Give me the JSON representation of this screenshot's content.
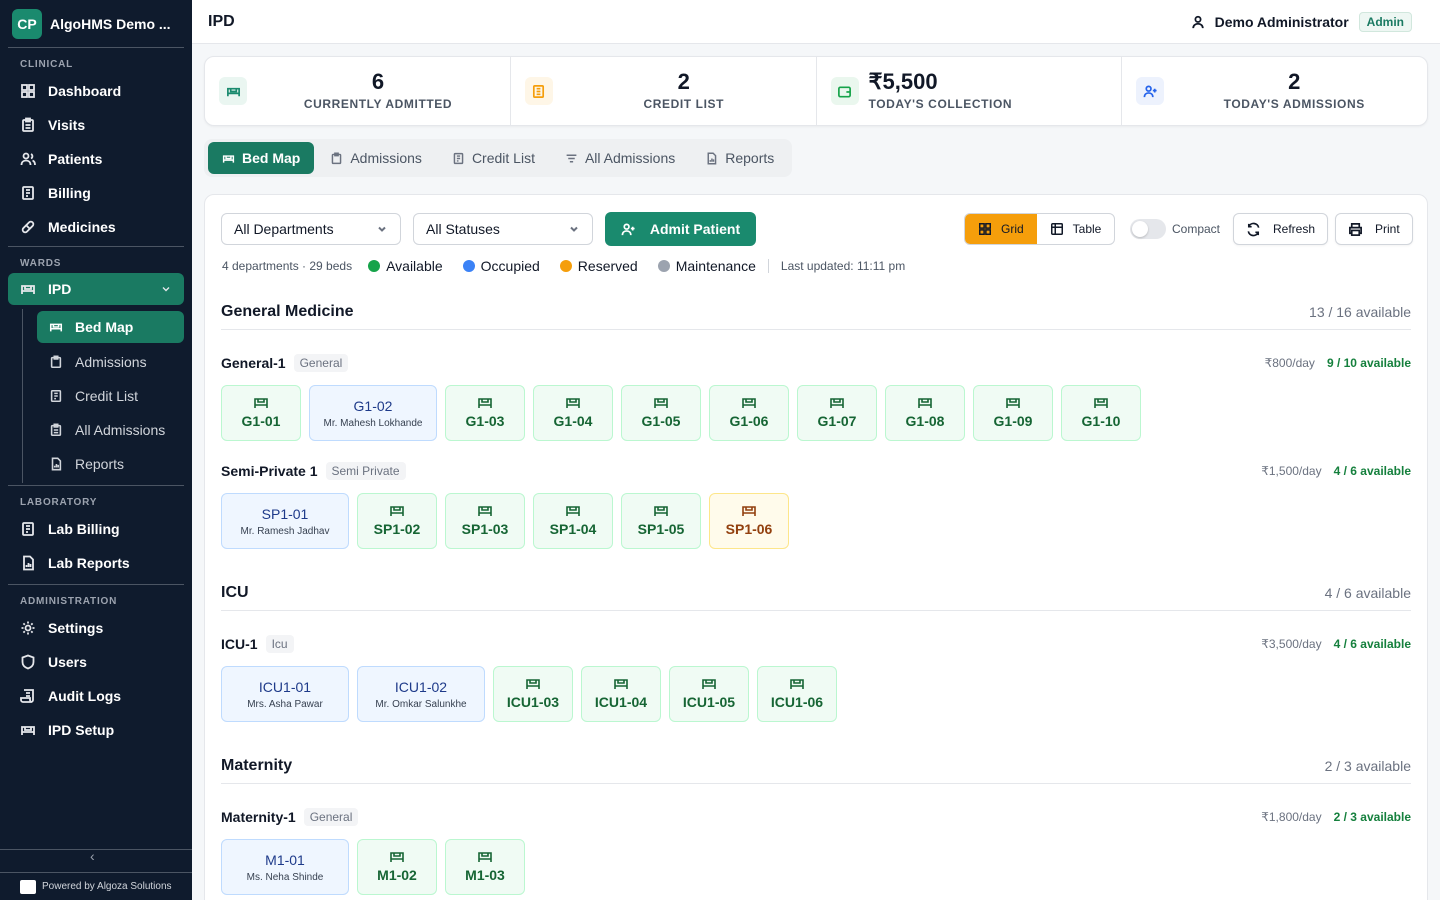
{
  "brand": {
    "initials": "CP",
    "name": "AlgoHMS Demo ..."
  },
  "sidebar": {
    "sections": [
      {
        "label": "CLINICAL",
        "items": [
          "Dashboard",
          "Visits",
          "Patients",
          "Billing",
          "Medicines"
        ]
      },
      {
        "label": "WARDS",
        "active": "IPD",
        "sub": [
          "Bed Map",
          "Admissions",
          "Credit List",
          "All Admissions",
          "Reports"
        ]
      },
      {
        "label": "LABORATORY",
        "items": [
          "Lab Billing",
          "Lab Reports"
        ]
      },
      {
        "label": "ADMINISTRATION",
        "items": [
          "Settings",
          "Users",
          "Audit Logs",
          "IPD Setup"
        ]
      }
    ],
    "powered": "Powered by Algoza Solutions",
    "collapse": "‹"
  },
  "header": {
    "title": "IPD",
    "user": "Demo Administrator",
    "role": "Admin"
  },
  "stats": [
    {
      "value": "6",
      "label": "CURRENTLY ADMITTED",
      "color": "#1a8a6e",
      "icon": "bed-icon"
    },
    {
      "value": "2",
      "label": "CREDIT LIST",
      "color": "#f59e0b",
      "icon": "clipboard-icon"
    },
    {
      "value": "₹5,500",
      "label": "TODAY'S COLLECTION",
      "color": "#16a34a",
      "icon": "wallet-icon"
    },
    {
      "value": "2",
      "label": "TODAY'S ADMISSIONS",
      "color": "#2563eb",
      "icon": "user-plus-icon"
    }
  ],
  "tabs": [
    "Bed Map",
    "Admissions",
    "Credit List",
    "All Admissions",
    "Reports"
  ],
  "toolbar": {
    "department": "All Departments",
    "status": "All Statuses",
    "admit": "Admit Patient",
    "grid": "Grid",
    "table": "Table",
    "compact": "Compact",
    "refresh": "Refresh",
    "print": "Print"
  },
  "legend": {
    "meta": "4 departments · 29 beds",
    "items": [
      {
        "label": "Available",
        "color": "#16a34a"
      },
      {
        "label": "Occupied",
        "color": "#3b82f6"
      },
      {
        "label": "Reserved",
        "color": "#f59e0b"
      },
      {
        "label": "Maintenance",
        "color": "#9ca3af"
      }
    ],
    "updated": "Last updated: 11:11 pm"
  },
  "departments": [
    {
      "name": "General Medicine",
      "avail": "13 / 16 available"
    },
    {
      "name": "ICU",
      "avail": "4 / 6 available"
    },
    {
      "name": "Maternity",
      "avail": "2 / 3 available"
    }
  ],
  "wards": [
    {
      "name": "General-1",
      "type": "General",
      "rate": "₹800/day",
      "avail": "9 / 10 available",
      "beds": [
        {
          "code": "G1-01",
          "s": "avail"
        },
        {
          "code": "G1-02",
          "s": "occ",
          "patient": "Mr. Mahesh Lokhande"
        },
        {
          "code": "G1-03",
          "s": "avail"
        },
        {
          "code": "G1-04",
          "s": "avail"
        },
        {
          "code": "G1-05",
          "s": "avail"
        },
        {
          "code": "G1-06",
          "s": "avail"
        },
        {
          "code": "G1-07",
          "s": "avail"
        },
        {
          "code": "G1-08",
          "s": "avail"
        },
        {
          "code": "G1-09",
          "s": "avail"
        },
        {
          "code": "G1-10",
          "s": "avail"
        }
      ]
    },
    {
      "name": "Semi-Private 1",
      "type": "Semi Private",
      "rate": "₹1,500/day",
      "avail": "4 / 6 available",
      "beds": [
        {
          "code": "SP1-01",
          "s": "occ",
          "patient": "Mr. Ramesh Jadhav"
        },
        {
          "code": "SP1-02",
          "s": "avail"
        },
        {
          "code": "SP1-03",
          "s": "avail"
        },
        {
          "code": "SP1-04",
          "s": "avail"
        },
        {
          "code": "SP1-05",
          "s": "avail"
        },
        {
          "code": "SP1-06",
          "s": "res"
        }
      ]
    },
    {
      "name": "ICU-1",
      "type": "Icu",
      "rate": "₹3,500/day",
      "avail": "4 / 6 available",
      "beds": [
        {
          "code": "ICU1-01",
          "s": "occ",
          "patient": "Mrs. Asha Pawar"
        },
        {
          "code": "ICU1-02",
          "s": "occ",
          "patient": "Mr. Omkar Salunkhe"
        },
        {
          "code": "ICU1-03",
          "s": "avail"
        },
        {
          "code": "ICU1-04",
          "s": "avail"
        },
        {
          "code": "ICU1-05",
          "s": "avail"
        },
        {
          "code": "ICU1-06",
          "s": "avail"
        }
      ]
    },
    {
      "name": "Maternity-1",
      "type": "General",
      "rate": "₹1,800/day",
      "avail": "2 / 3 available",
      "beds": [
        {
          "code": "M1-01",
          "s": "occ",
          "patient": "Ms. Neha Shinde"
        },
        {
          "code": "M1-02",
          "s": "avail"
        },
        {
          "code": "M1-03",
          "s": "avail"
        }
      ]
    }
  ]
}
